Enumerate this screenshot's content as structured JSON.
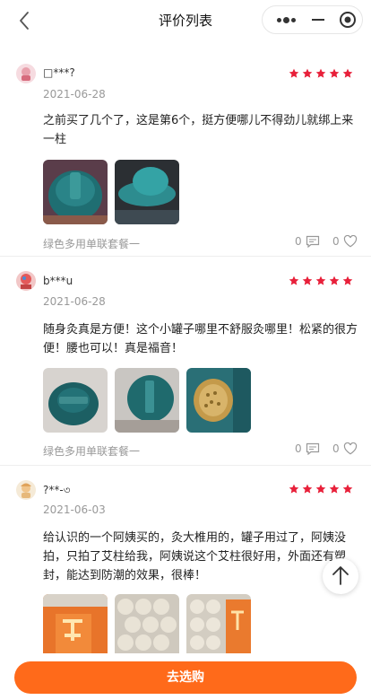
{
  "header": {
    "title": "评价列表"
  },
  "colors": {
    "star": "#e8203a",
    "accent": "#ff6a1a",
    "muted": "#999999"
  },
  "reviews": [
    {
      "user": "□***?",
      "date": "2021-06-28",
      "rating": 5,
      "text": "之前买了几个了，这是第6个，挺方便哪儿不得劲儿就绑上来一柱",
      "variant": "绿色多用单联套餐一",
      "comments": "0",
      "likes": "0"
    },
    {
      "user": "b***u",
      "date": "2021-06-28",
      "rating": 5,
      "text": "随身灸真是方便！这个小罐子哪里不舒服灸哪里！松紧的很方便！腰也可以！真是福音！",
      "variant": "绿色多用单联套餐一",
      "comments": "0",
      "likes": "0"
    },
    {
      "user": "?**-৩",
      "date": "2021-06-03",
      "rating": 5,
      "text": "给认识的一个阿姨买的，灸大椎用的，罐子用过了，阿姨没拍，只拍了艾柱给我，阿姨说这个艾柱很好用，外面还有塑封，能达到防潮的效果，很棒！"
    }
  ],
  "footer": {
    "buy_label": "去选购"
  },
  "icons": {
    "back": "chevron-left-icon",
    "more": "more-dots-icon",
    "minimize": "minus-icon",
    "close": "target-circle-icon",
    "comment": "comment-icon",
    "like": "heart-icon",
    "to_top": "arrow-up-icon"
  }
}
